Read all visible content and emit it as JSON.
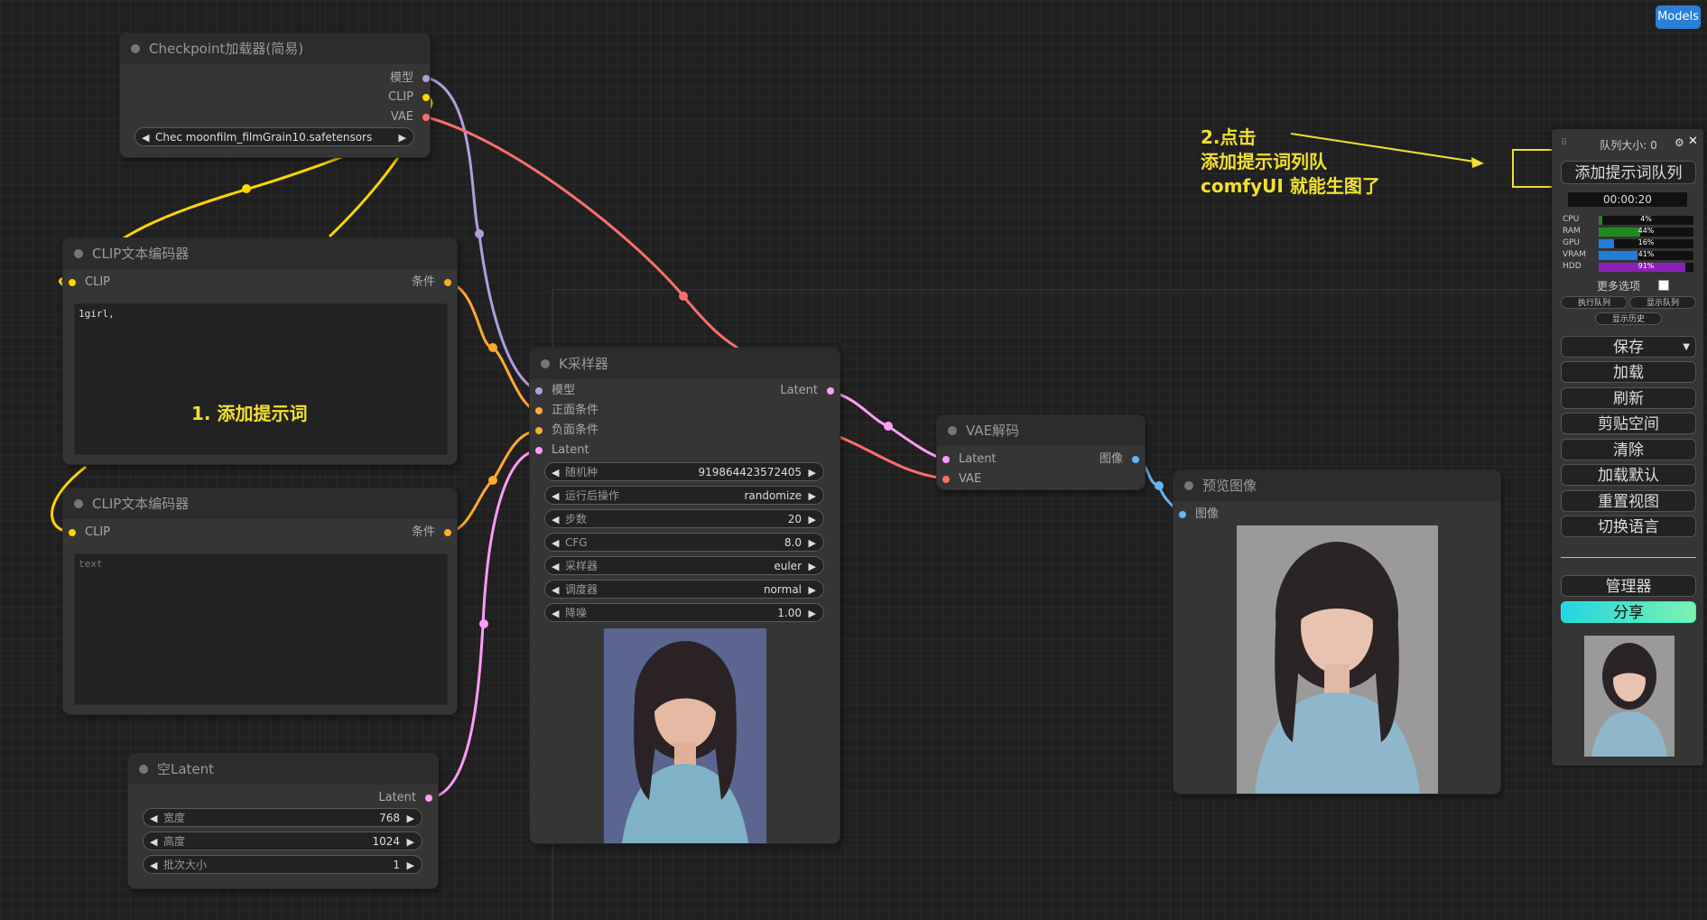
{
  "top_button": {
    "label": "Models",
    "color": "#2a7fd6"
  },
  "nodes": {
    "checkpoint": {
      "title": "Checkpoint加载器(简易)",
      "outputs": [
        "模型",
        "CLIP",
        "VAE"
      ],
      "widget_label": "Checkpoint名称",
      "widget_value": "Chec moonfilm_filmGrain10.safetensors"
    },
    "clip_pos": {
      "title": "CLIP文本编码器",
      "input": "CLIP",
      "output": "条件",
      "text": "1girl,"
    },
    "clip_neg": {
      "title": "CLIP文本编码器",
      "input": "CLIP",
      "output": "条件",
      "placeholder": "text"
    },
    "empty_latent": {
      "title": "空Latent",
      "output": "Latent",
      "widgets": [
        {
          "label": "宽度",
          "value": "768"
        },
        {
          "label": "高度",
          "value": "1024"
        },
        {
          "label": "批次大小",
          "value": "1"
        }
      ]
    },
    "ksampler": {
      "title": "K采样器",
      "inputs": [
        "模型",
        "正面条件",
        "负面条件",
        "Latent"
      ],
      "output": "Latent",
      "widgets": [
        {
          "label": "随机种",
          "value": "919864423572405"
        },
        {
          "label": "运行后操作",
          "value": "randomize"
        },
        {
          "label": "步数",
          "value": "20"
        },
        {
          "label": "CFG",
          "value": "8.0"
        },
        {
          "label": "采样器",
          "value": "euler"
        },
        {
          "label": "调度器",
          "value": "normal"
        },
        {
          "label": "降噪",
          "value": "1.00"
        }
      ]
    },
    "vae_decode": {
      "title": "VAE解码",
      "inputs": [
        "Latent",
        "VAE"
      ],
      "output": "图像"
    },
    "preview": {
      "title": "预览图像",
      "input": "图像"
    }
  },
  "annotations": {
    "step1": "1. 添加提示词",
    "step2_line1": "2.点击",
    "step2_line2": "添加提示词列队",
    "step2_line3": "comfyUI 就能生图了"
  },
  "queue_panel": {
    "header": "队列大小: 0",
    "queue_button": "添加提示词队列",
    "timer": "00:00:20",
    "meters": [
      {
        "label": "CPU",
        "value": "4%",
        "fraction": 0.04,
        "color": "#1f8a1f"
      },
      {
        "label": "RAM",
        "value": "44%",
        "fraction": 0.44,
        "color": "#1f8a1f"
      },
      {
        "label": "GPU",
        "value": "16%",
        "fraction": 0.16,
        "color": "#1f7fd6"
      },
      {
        "label": "VRAM",
        "value": "41%",
        "fraction": 0.41,
        "color": "#1f7fd6"
      },
      {
        "label": "HDD",
        "value": "91%",
        "fraction": 0.91,
        "color": "#8a22b8"
      }
    ],
    "more_options": "更多选项",
    "small_buttons": [
      "执行队列",
      "显示队列",
      "显示历史"
    ],
    "menu": [
      "保存",
      "加载",
      "刷新",
      "剪贴空间",
      "清除",
      "加载默认",
      "重置视图",
      "切换语言"
    ],
    "manager": "管理器",
    "share": "分享"
  },
  "slot_colors": {
    "model": "#b39ddb",
    "clip": "#ffd500",
    "vae": "#ff6e6e",
    "conditioning": "#ffa931",
    "latent": "#ff9cf9",
    "image": "#64b5f6"
  }
}
